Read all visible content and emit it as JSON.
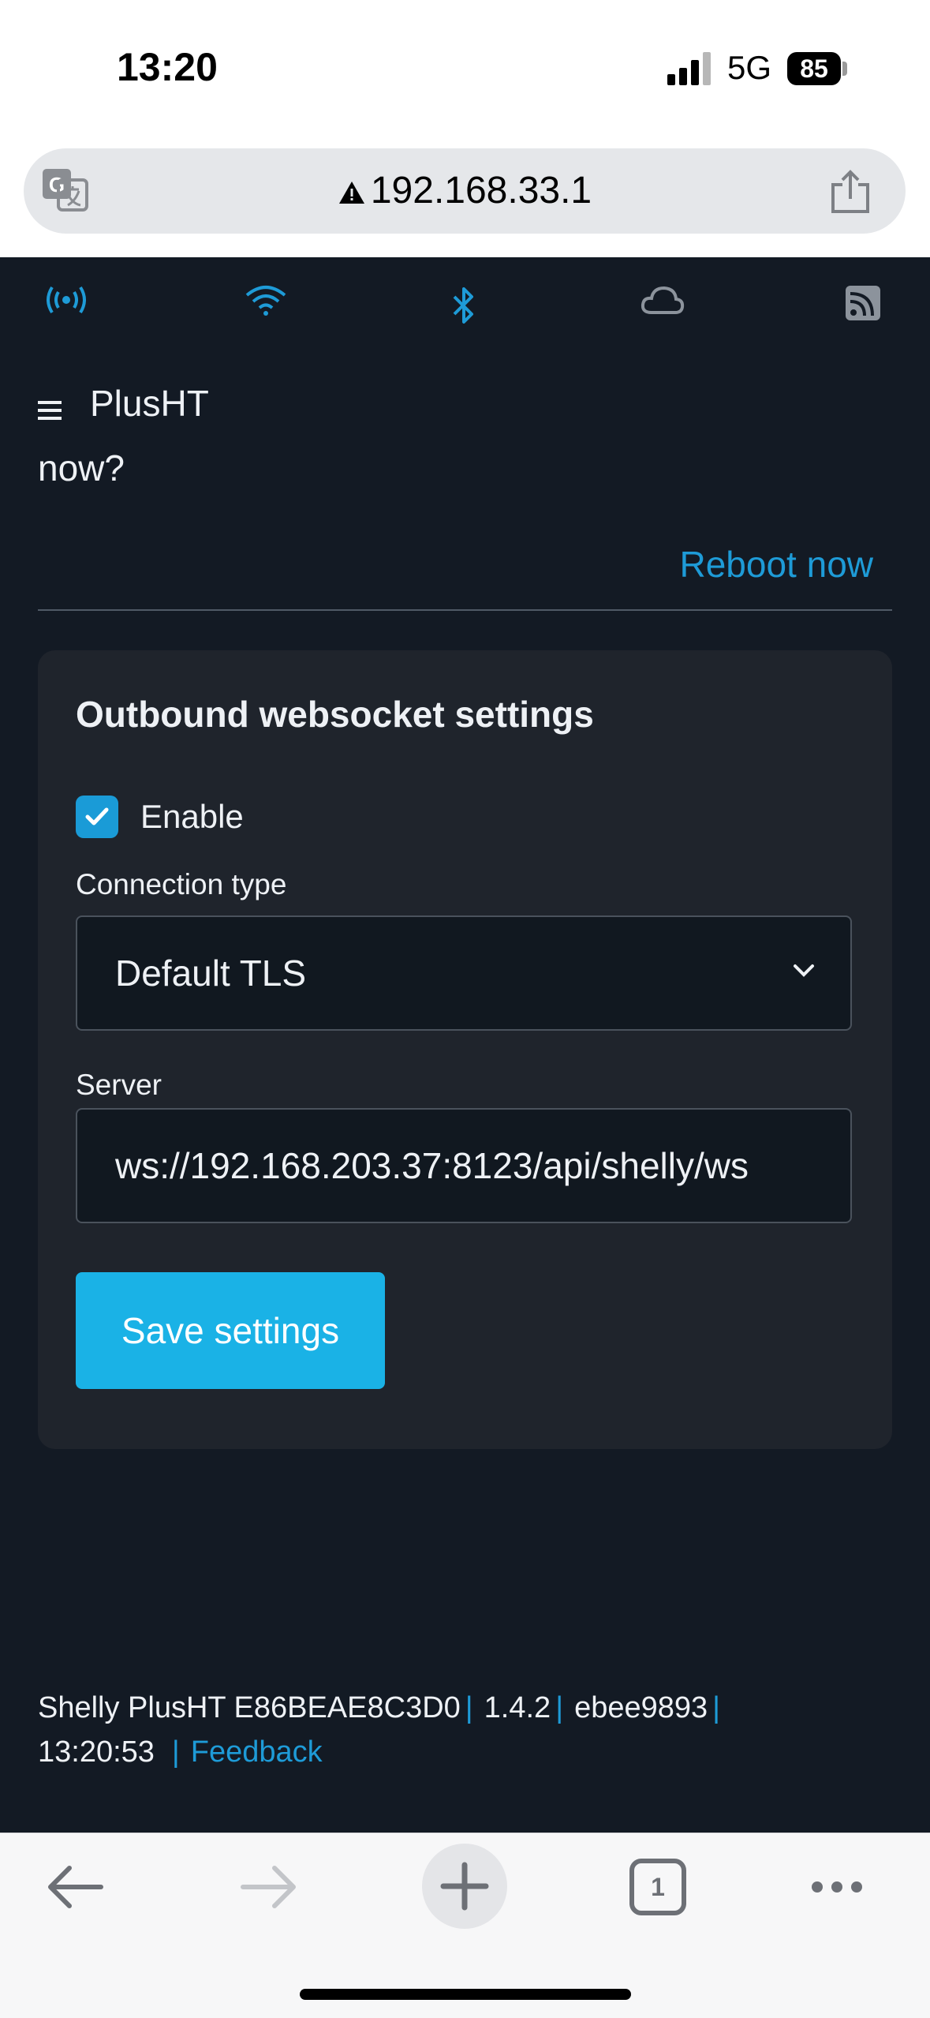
{
  "status_bar": {
    "time": "13:20",
    "network": "5G",
    "battery": "85"
  },
  "browser": {
    "url": "192.168.33.1",
    "icons": [
      "translate-icon",
      "warning-icon",
      "share-icon"
    ]
  },
  "device": {
    "top_icons": [
      "broadcast-icon",
      "wifi-icon",
      "bluetooth-icon",
      "cloud-icon",
      "rss-icon"
    ],
    "name": "PlusHT",
    "prompt_fragment": "now?",
    "reboot_link": "Reboot now"
  },
  "websocket_card": {
    "title": "Outbound websocket settings",
    "enable_label": "Enable",
    "enable_checked": true,
    "connection_type_label": "Connection type",
    "connection_type_value": "Default TLS",
    "server_label": "Server",
    "server_value": "ws://192.168.203.37:8123/api/shelly/ws",
    "save_button": "Save settings"
  },
  "footer": {
    "model_id": "Shelly PlusHT E86BEAE8C3D0",
    "version": "1.4.2",
    "build": "ebee9893",
    "time": "13:20:53",
    "feedback": "Feedback",
    "separator": "|"
  },
  "toolbar": {
    "tab_count": "1",
    "icons": [
      "back-icon",
      "forward-icon",
      "new-tab-icon",
      "tabs-icon",
      "more-icon"
    ]
  },
  "colors": {
    "page_bg": "#131a24",
    "card_bg": "#1f242c",
    "accent": "#1e9bd7",
    "button": "#1ab2e6"
  }
}
